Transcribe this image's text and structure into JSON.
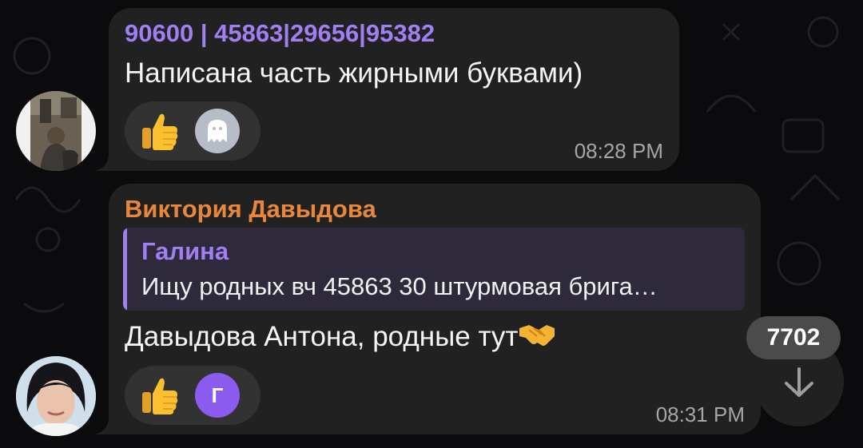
{
  "messages": [
    {
      "sender": "90600 | 45863|29656|95382",
      "text": "Написана часть жирными буквами)",
      "time": "08:28 PM",
      "reaction_emoji": "thumbs-up",
      "reactor_icon": "ghost-icon"
    },
    {
      "sender": "Виктория Давыдова",
      "reply": {
        "name": "Галина",
        "text": "Ищу родных вч 45863 30 штурмовая брига…"
      },
      "text": "Давыдова Антона, родные тут",
      "text_emoji": "handshake",
      "time": "08:31 PM",
      "reaction_emoji": "thumbs-up",
      "reactor_initial": "Г"
    }
  ],
  "unread_count": "7702",
  "colors": {
    "sender1": "#9f7ff2",
    "sender2": "#e8873b",
    "bubble": "#212121",
    "reply_bg": "#2f2a3b",
    "reactor2": "#8c5cf0"
  }
}
